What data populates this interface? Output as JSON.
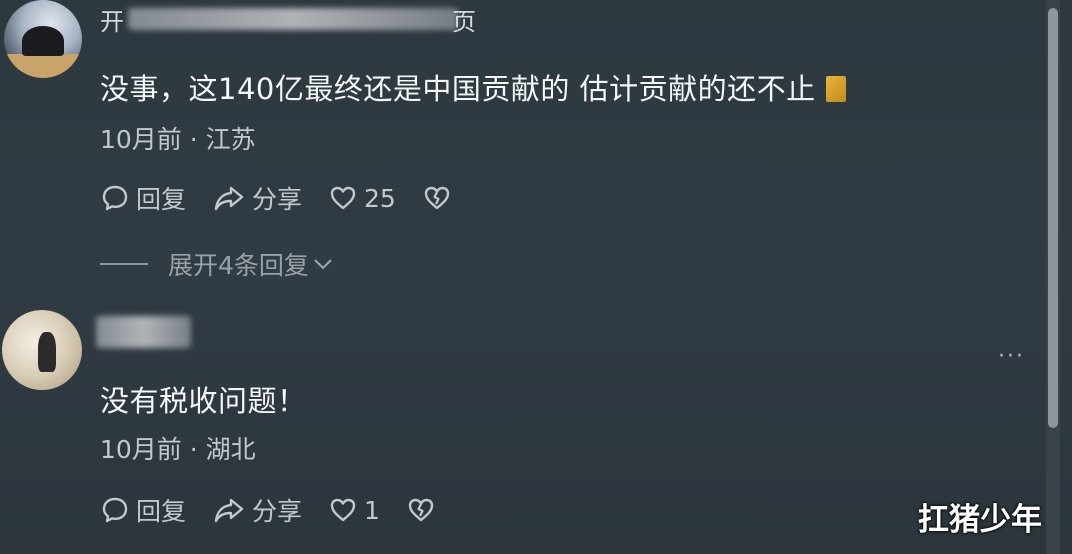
{
  "comments": [
    {
      "username_visible_fragment": "开",
      "username_tail_fragment": "页",
      "text": "没事，这140亿最终还是中国贡献的  估计贡献的还不止",
      "emoji": "gold-emoji",
      "time": "10月前",
      "location": "江苏",
      "reply_label": "回复",
      "share_label": "分享",
      "likes": "25",
      "expand_label": "展开4条回复"
    },
    {
      "text": "没有税收问题！",
      "time": "10月前",
      "location": "湖北",
      "reply_label": "回复",
      "share_label": "分享",
      "likes": "1",
      "more_label": "···"
    }
  ],
  "separator": " · ",
  "watermark": "扛猪少年",
  "colors": {
    "background": "#2f3941",
    "text": "#f4f6f8",
    "meta": "#c3c8cc"
  }
}
